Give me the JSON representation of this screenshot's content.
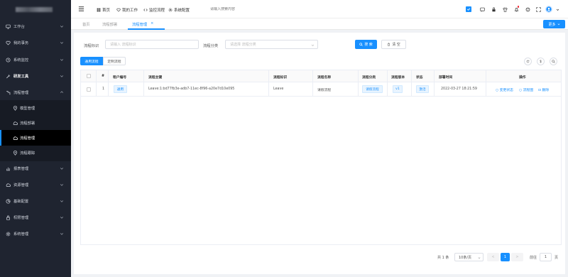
{
  "sidebar": {
    "items": [
      {
        "label": "工作台",
        "icon": "monitor-icon"
      },
      {
        "label": "我的事务",
        "icon": "heart-icon"
      },
      {
        "label": "系统监控",
        "icon": "eye-icon"
      },
      {
        "label": "研发工具",
        "icon": "wrench-icon"
      },
      {
        "label": "流程管理",
        "icon": "flow-icon"
      },
      {
        "label": "模型管理",
        "icon": "map-pin-icon"
      },
      {
        "label": "流程部署",
        "icon": "cloud-icon"
      },
      {
        "label": "流程管理",
        "icon": "cloud-icon"
      },
      {
        "label": "流程跟踪",
        "icon": "location-icon"
      },
      {
        "label": "报表管理",
        "icon": "chart-icon"
      },
      {
        "label": "资源管理",
        "icon": "cloud-icon"
      },
      {
        "label": "基础配置",
        "icon": "pie-icon"
      },
      {
        "label": "权限管理",
        "icon": "lock-icon"
      },
      {
        "label": "系统管理",
        "icon": "gear-icon"
      }
    ]
  },
  "header": {
    "nav": [
      "首页",
      "我的工作",
      "监控流程",
      "系统配置"
    ],
    "search_placeholder": "请输入搜索内容"
  },
  "tabs": {
    "items": [
      "首页",
      "流程部署",
      "流程管理"
    ],
    "close": "×",
    "more_label": "更多"
  },
  "filters": {
    "key_label": "流程标识",
    "key_placeholder": "请输入 流程标识",
    "category_label": "流程分类",
    "category_placeholder": "请选择 流程分类",
    "search_btn": "搜 索",
    "reset_btn": "清 空"
  },
  "segments": {
    "general": "通用流程",
    "custom": "定制流程"
  },
  "table": {
    "headers": [
      "#",
      "租户编号",
      "流程主键",
      "流程标识",
      "流程名称",
      "流程分类",
      "流程版本",
      "状态",
      "部署时间",
      "操作"
    ],
    "rows": [
      {
        "index": "1",
        "tenant": "通用",
        "id": "Leave:1:bd77fb3e-adb7-11ec-8f96-a20e7d10e095",
        "key": "Leave",
        "name": "请假流程",
        "category": "请假流程",
        "version": "v1",
        "status": "激活",
        "deploy_time": "2022-03-27 18:21:59",
        "actions": {
          "change_status": "变更状态",
          "diagram": "流程图",
          "delete": "删除"
        }
      }
    ]
  },
  "pagination": {
    "total": "共 1 条",
    "page_size": "10条/页",
    "prev": "<",
    "current": "1",
    "next": ">",
    "goto_label": "前往",
    "goto_value": "1",
    "page_unit": "页"
  },
  "colors": {
    "accent": "#1890ff",
    "sidebar_bg": "#1f2430",
    "sidebar_active": "#000000"
  }
}
